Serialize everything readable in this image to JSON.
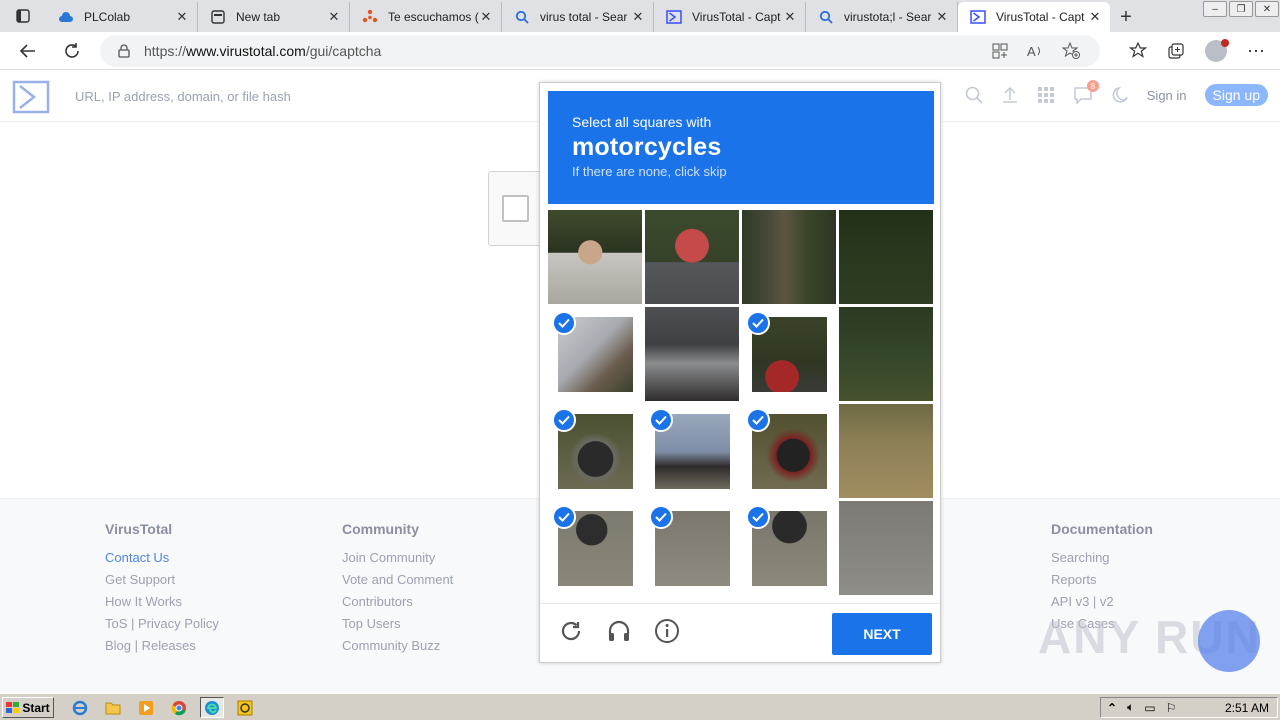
{
  "browser": {
    "tabs": [
      {
        "title": "PLColab",
        "icon": "cloud-icon",
        "active": false
      },
      {
        "title": "New tab",
        "icon": "newtab-icon",
        "active": false
      },
      {
        "title": "Te escuchamos (",
        "icon": "people-icon",
        "active": false
      },
      {
        "title": "virus total - Sear",
        "icon": "search-icon",
        "active": false
      },
      {
        "title": "VirusTotal - Capt",
        "icon": "virustotal-icon",
        "active": false
      },
      {
        "title": "virustota;l - Sear",
        "icon": "search-icon",
        "active": false
      },
      {
        "title": "VirusTotal - Capt",
        "icon": "virustotal-icon",
        "active": true
      }
    ],
    "url_prefix": "https://",
    "url_host": "www.virustotal.com",
    "url_path": "/gui/captcha"
  },
  "vt": {
    "search_placeholder": "URL, IP address, domain, or file hash",
    "notification_count": "8",
    "sign_in": "Sign in",
    "sign_up": "Sign up"
  },
  "footer": {
    "columns": [
      {
        "title": "VirusTotal",
        "links": [
          "Contact Us",
          "Get Support",
          "How It Works",
          "ToS | Privacy Policy",
          "Blog | Releases"
        ]
      },
      {
        "title": "Community",
        "links": [
          "Join Community",
          "Vote and Comment",
          "Contributors",
          "Top Users",
          "Community Buzz"
        ]
      },
      {
        "title": "Documentation",
        "links": [
          "Searching",
          "Reports",
          "API v3 | v2",
          "Use Cases"
        ]
      }
    ]
  },
  "captcha": {
    "instruction": "Select all squares with",
    "target": "motorcycles",
    "hint": "If there are none, click skip",
    "next_label": "NEXT",
    "grid": [
      [
        {
          "selected": false,
          "scene": "boy-face"
        },
        {
          "selected": false,
          "scene": "helmet-rider"
        },
        {
          "selected": false,
          "scene": "tree-trunk"
        },
        {
          "selected": false,
          "scene": "dark-foliage"
        }
      ],
      [
        {
          "selected": true,
          "scene": "boy-jacket"
        },
        {
          "selected": false,
          "scene": "rider-body"
        },
        {
          "selected": true,
          "scene": "bike-rear"
        },
        {
          "selected": false,
          "scene": "foliage"
        }
      ],
      [
        {
          "selected": true,
          "scene": "front-wheel"
        },
        {
          "selected": true,
          "scene": "rider-legs"
        },
        {
          "selected": true,
          "scene": "rear-wheel"
        },
        {
          "selected": false,
          "scene": "dry-grass"
        }
      ],
      [
        {
          "selected": true,
          "scene": "road-wheel"
        },
        {
          "selected": true,
          "scene": "road"
        },
        {
          "selected": true,
          "scene": "road-wheel-2"
        },
        {
          "selected": false,
          "scene": "road-grey"
        }
      ]
    ]
  },
  "watermark": "ANY RUN",
  "taskbar": {
    "start_label": "Start",
    "clock": "2:51 AM"
  }
}
